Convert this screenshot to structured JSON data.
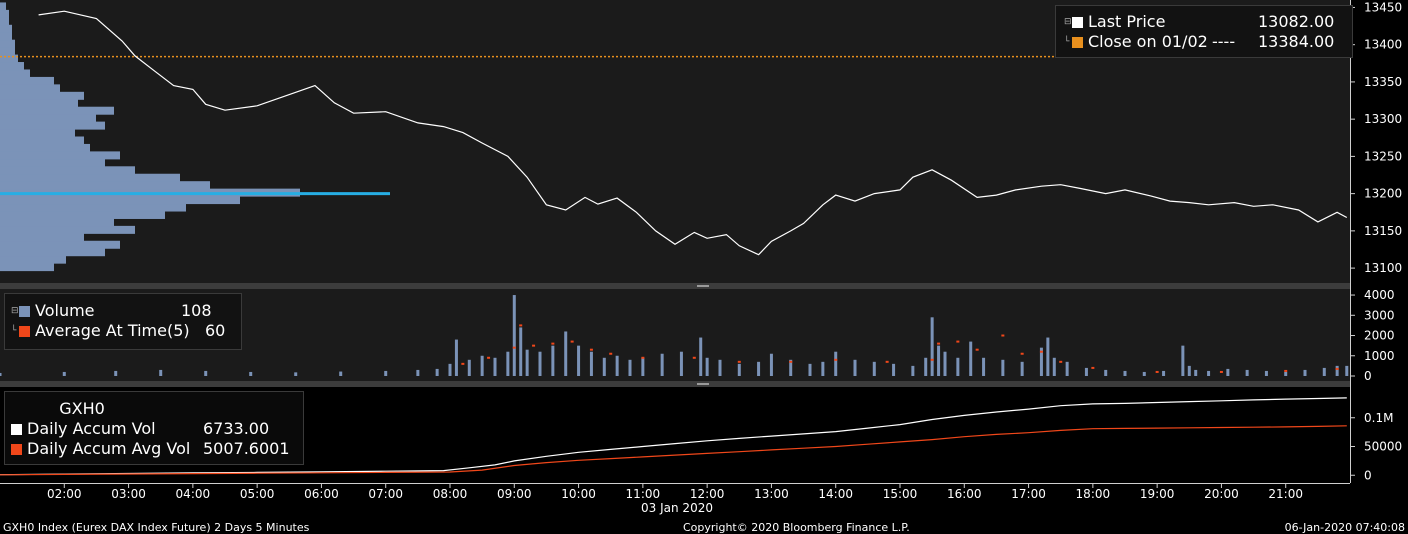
{
  "colors": {
    "background": "#1b1b1b",
    "price_line": "#ffffff",
    "close_line": "#e8901e",
    "volume_bar": "#7b93b8",
    "avg_marker": "#f0471a",
    "accum_vol": "#ffffff",
    "accum_avg": "#f0471a",
    "profile_bar": "#7b93b8",
    "profile_highlight": "#27aee4"
  },
  "chart_data": [
    {
      "type": "line",
      "panel": "price",
      "ylim": [
        13080,
        13460
      ],
      "yticks": [
        13100,
        13150,
        13200,
        13250,
        13300,
        13350,
        13400,
        13450
      ],
      "legend": {
        "last_price_label": "Last Price",
        "last_price_value": "13082.00",
        "close_label": "Close on 01/02",
        "close_dashes": "----",
        "close_value": "13384.00"
      },
      "close_level": 13384,
      "series": [
        {
          "name": "Last Price",
          "x": [
            1.6,
            2.0,
            2.5,
            2.9,
            3.1,
            3.4,
            3.7,
            4.0,
            4.2,
            4.5,
            5.0,
            5.5,
            5.9,
            6.2,
            6.5,
            7.0,
            7.5,
            7.9,
            8.2,
            8.5,
            8.9,
            9.2,
            9.5,
            9.8,
            10.1,
            10.3,
            10.6,
            10.9,
            11.2,
            11.5,
            11.8,
            12.0,
            12.3,
            12.5,
            12.8,
            13.0,
            13.3,
            13.5,
            13.8,
            14.0,
            14.3,
            14.6,
            15.0,
            15.2,
            15.5,
            15.8,
            16.2,
            16.5,
            16.8,
            17.2,
            17.5,
            17.8,
            18.2,
            18.5,
            18.9,
            19.2,
            19.5,
            19.8,
            20.2,
            20.5,
            20.8,
            21.2,
            21.5,
            21.8,
            21.95
          ],
          "values": [
            13440,
            13445,
            13435,
            13405,
            13385,
            13365,
            13345,
            13340,
            13320,
            13312,
            13318,
            13333,
            13345,
            13322,
            13308,
            13310,
            13295,
            13290,
            13282,
            13268,
            13250,
            13222,
            13185,
            13178,
            13195,
            13186,
            13194,
            13175,
            13150,
            13132,
            13148,
            13140,
            13145,
            13130,
            13118,
            13136,
            13150,
            13160,
            13185,
            13198,
            13190,
            13200,
            13205,
            13222,
            13232,
            13218,
            13195,
            13198,
            13205,
            13210,
            13212,
            13207,
            13200,
            13205,
            13197,
            13190,
            13188,
            13185,
            13188,
            13183,
            13185,
            13178,
            13162,
            13175,
            13168
          ]
        }
      ]
    },
    {
      "type": "bar",
      "panel": "volume",
      "ylim": [
        0,
        4200
      ],
      "yticks": [
        0,
        1000,
        2000,
        3000,
        4000
      ],
      "legend": {
        "volume_label": "Volume",
        "volume_value": "108",
        "avg_label": "Average At Time(5)",
        "avg_value": "60"
      },
      "volume_x": [
        0.4,
        1.0,
        2.0,
        2.8,
        3.5,
        4.2,
        4.9,
        5.6,
        6.3,
        7.0,
        7.5,
        7.8,
        8.0,
        8.1,
        8.3,
        8.5,
        8.7,
        8.9,
        9.0,
        9.1,
        9.2,
        9.4,
        9.6,
        9.8,
        10.0,
        10.2,
        10.4,
        10.6,
        10.8,
        11.0,
        11.3,
        11.6,
        11.9,
        12.0,
        12.2,
        12.5,
        12.8,
        13.0,
        13.3,
        13.6,
        13.8,
        14.0,
        14.3,
        14.6,
        14.9,
        15.2,
        15.4,
        15.5,
        15.6,
        15.7,
        15.9,
        16.1,
        16.3,
        16.6,
        16.9,
        17.2,
        17.3,
        17.4,
        17.6,
        17.9,
        18.2,
        18.5,
        18.8,
        19.1,
        19.4,
        19.5,
        19.6,
        19.8,
        20.1,
        20.4,
        20.7,
        21.0,
        21.3,
        21.6,
        21.8,
        21.95
      ],
      "volume_values": [
        120,
        150,
        200,
        250,
        300,
        250,
        200,
        180,
        220,
        250,
        300,
        350,
        600,
        1800,
        800,
        1000,
        900,
        1200,
        4000,
        2400,
        1300,
        1200,
        1500,
        2200,
        1500,
        1200,
        900,
        1000,
        800,
        900,
        1100,
        1200,
        1900,
        900,
        800,
        600,
        700,
        1100,
        800,
        600,
        700,
        1200,
        800,
        700,
        600,
        500,
        900,
        2900,
        1500,
        1200,
        900,
        1700,
        900,
        800,
        700,
        1400,
        1900,
        900,
        700,
        400,
        300,
        250,
        200,
        250,
        1500,
        500,
        300,
        250,
        350,
        300,
        250,
        200,
        300,
        400,
        500,
        500
      ],
      "avg_x": [
        8.2,
        8.6,
        9.0,
        9.1,
        9.3,
        9.6,
        9.9,
        10.2,
        10.5,
        11.0,
        11.8,
        12.5,
        13.3,
        14.0,
        14.8,
        15.5,
        15.6,
        15.9,
        16.2,
        16.6,
        16.9,
        17.2,
        17.5,
        18.0,
        19.0,
        20.0,
        21.0,
        21.8
      ],
      "avg_values": [
        600,
        900,
        1400,
        2500,
        1500,
        1600,
        1700,
        1300,
        1100,
        900,
        900,
        700,
        700,
        800,
        700,
        800,
        1600,
        1700,
        1300,
        2000,
        1100,
        1200,
        700,
        400,
        200,
        200,
        250,
        350
      ]
    },
    {
      "type": "line",
      "panel": "accum",
      "ylim": [
        -10000,
        150000
      ],
      "yticks": [
        0,
        50000,
        100000
      ],
      "ytick_labels": [
        "0",
        "50000",
        "0.1M"
      ],
      "legend": {
        "title": "GXH0",
        "accum_vol_label": "Daily Accum Vol",
        "accum_vol_value": "6733.00",
        "accum_avg_label": "Daily Accum Avg Vol",
        "accum_avg_value": "5007.6001"
      },
      "series": [
        {
          "name": "Daily Accum Vol",
          "x": [
            1.0,
            2.0,
            3.0,
            4.0,
            5.0,
            6.0,
            7.0,
            7.9,
            8.3,
            8.7,
            9.0,
            9.5,
            10.0,
            10.5,
            11.0,
            11.5,
            12.0,
            12.5,
            13.0,
            13.5,
            14.0,
            14.5,
            15.0,
            15.5,
            16.0,
            16.5,
            17.0,
            17.5,
            18.0,
            18.5,
            19.0,
            19.5,
            20.0,
            20.5,
            21.0,
            21.5,
            21.95
          ],
          "values": [
            1000,
            2000,
            3000,
            4000,
            5000,
            6000,
            7000,
            8000,
            13000,
            18000,
            25000,
            33000,
            40000,
            45000,
            50000,
            55000,
            60000,
            64000,
            68000,
            72000,
            76000,
            82000,
            88000,
            97000,
            104000,
            110000,
            115000,
            121000,
            124000,
            125000,
            126500,
            128000,
            129500,
            131000,
            132500,
            133500,
            134500
          ]
        },
        {
          "name": "Daily Accum Avg Vol",
          "x": [
            1.0,
            2.0,
            3.0,
            4.0,
            5.0,
            6.0,
            7.0,
            8.0,
            8.5,
            9.0,
            9.5,
            10.0,
            10.5,
            11.0,
            11.5,
            12.0,
            12.5,
            13.0,
            13.5,
            14.0,
            14.5,
            15.0,
            15.5,
            16.0,
            16.5,
            17.0,
            17.5,
            18.0,
            18.5,
            19.0,
            19.5,
            20.0,
            20.5,
            21.0,
            21.5,
            21.95
          ],
          "values": [
            800,
            1500,
            2200,
            2900,
            3600,
            4300,
            5000,
            5700,
            9000,
            17000,
            22000,
            26000,
            29000,
            32000,
            35000,
            38000,
            41000,
            44000,
            47000,
            50000,
            54000,
            58000,
            62000,
            67000,
            71000,
            74000,
            78000,
            81000,
            81500,
            82000,
            82500,
            83000,
            83500,
            84000,
            85000,
            86000
          ]
        }
      ]
    }
  ],
  "volume_profile": {
    "levels": [
      13100,
      13110,
      13120,
      13130,
      13140,
      13150,
      13160,
      13170,
      13180,
      13190,
      13200,
      13210,
      13220,
      13230,
      13240,
      13250,
      13260,
      13270,
      13280,
      13290,
      13300,
      13310,
      13320,
      13330,
      13340,
      13350,
      13360,
      13370,
      13380,
      13390,
      13400,
      13410,
      13420,
      13430,
      13440,
      13450
    ],
    "widths": [
      18,
      22,
      35,
      40,
      28,
      45,
      38,
      55,
      62,
      80,
      100,
      70,
      60,
      45,
      35,
      40,
      30,
      28,
      25,
      35,
      32,
      38,
      26,
      28,
      20,
      18,
      10,
      8,
      6,
      5,
      5,
      4,
      4,
      3,
      3,
      2
    ],
    "highlight_level": 13200
  },
  "time_axis": {
    "range": [
      1.0,
      22.0
    ],
    "ticks": [
      2,
      3,
      4,
      5,
      6,
      7,
      8,
      9,
      10,
      11,
      12,
      13,
      14,
      15,
      16,
      17,
      18,
      19,
      20,
      21
    ],
    "labels": [
      "02:00",
      "03:00",
      "04:00",
      "05:00",
      "06:00",
      "07:00",
      "08:00",
      "09:00",
      "10:00",
      "11:00",
      "12:00",
      "13:00",
      "14:00",
      "15:00",
      "16:00",
      "17:00",
      "18:00",
      "19:00",
      "20:00",
      "21:00"
    ],
    "date_label": "03 Jan 2020"
  },
  "footer": {
    "left": "GXH0 Index (Eurex DAX Index Future) 2 Days 5 Minutes",
    "center": "Copyright© 2020 Bloomberg Finance L.P.",
    "right": "06-Jan-2020 07:40:08"
  }
}
